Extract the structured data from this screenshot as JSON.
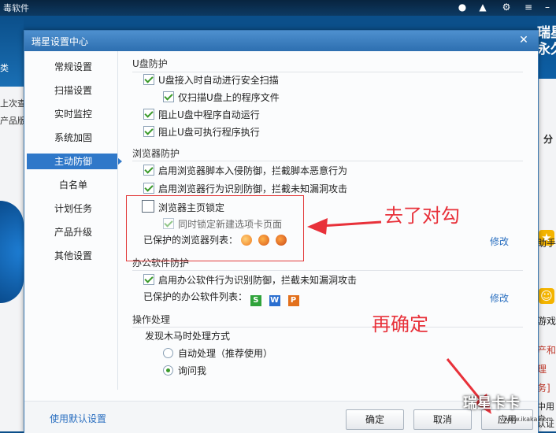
{
  "background_app": {
    "title_fragment": "毒软件",
    "top_icons": [
      "user-icon",
      "upload-icon",
      "settings-icon",
      "menu-icon"
    ],
    "left_texts": [
      "类",
      "上次查",
      "产品版"
    ],
    "right_title": "瑞星",
    "right_subtitle": "永久",
    "right_texts": [
      "分",
      "助手",
      "游戏",
      "产和",
      "理",
      "务]",
      "中用户",
      "认证"
    ]
  },
  "dialog": {
    "title": "瑞星设置中心",
    "close_symbol": "✕"
  },
  "sidebar": {
    "items": [
      {
        "label": "常规设置",
        "active": false
      },
      {
        "label": "扫描设置",
        "active": false
      },
      {
        "label": "实时监控",
        "active": false
      },
      {
        "label": "系统加固",
        "active": false
      },
      {
        "label": "主动防御",
        "active": true
      },
      {
        "label": "白名单",
        "active": false
      },
      {
        "label": "计划任务",
        "active": false
      },
      {
        "label": "产品升级",
        "active": false
      },
      {
        "label": "其他设置",
        "active": false
      }
    ]
  },
  "usb": {
    "title": "U盘防护",
    "options": [
      {
        "label": "U盘接入时自动进行安全扫描",
        "checked": true
      },
      {
        "label": "仅扫描U盘上的程序文件",
        "checked": true
      },
      {
        "label": "阻止U盘中程序自动运行",
        "checked": true
      },
      {
        "label": "阻止U盘可执行程序执行",
        "checked": true
      }
    ]
  },
  "browser": {
    "title": "浏览器防护",
    "options": [
      {
        "label": "启用浏览器脚本入侵防御，拦截脚本恶意行为",
        "checked": true
      },
      {
        "label": "启用浏览器行为识别防御，拦截未知漏洞攻击",
        "checked": true
      },
      {
        "label": "浏览器主页锁定",
        "checked": false
      },
      {
        "label": "同时锁定新建选项卡页面",
        "checked": true,
        "disabled": true
      }
    ],
    "protected_label": "已保护的浏览器列表：",
    "browsers": [
      {
        "name": "uc-browser-icon",
        "color": "#f07a1e"
      },
      {
        "name": "firefox-icon",
        "color": "#d9591c"
      },
      {
        "name": "firefox-icon-2",
        "color": "#c84a16"
      }
    ],
    "modify_link": "修改"
  },
  "office": {
    "title": "办公软件防护",
    "option": {
      "label": "启用办公软件行为识别防御，拦截未知漏洞攻击",
      "checked": true
    },
    "protected_label": "已保护的办公软件列表：",
    "apps": [
      {
        "name": "wps-spreadsheet-icon",
        "letter": "S",
        "color": "#2fa33b"
      },
      {
        "name": "wps-writer-icon",
        "letter": "W",
        "color": "#2b6fd0"
      },
      {
        "name": "wps-presentation-icon",
        "letter": "P",
        "color": "#e2701c"
      }
    ],
    "modify_link": "修改"
  },
  "operation": {
    "title": "操作处理",
    "subtitle": "发现木马时处理方式",
    "options": [
      {
        "label": "自动处理（推荐使用）",
        "selected": false
      },
      {
        "label": "询问我",
        "selected": true
      }
    ]
  },
  "footer": {
    "default_link": "使用默认设置",
    "ok": "确定",
    "cancel": "取消",
    "apply": "应用"
  },
  "annotations": {
    "unchecked_note": "去了对勾",
    "confirm_note": "再确定",
    "watermark": "瑞星卡卡",
    "watermark_url": "www.ikaka.com",
    "color": "#e8313a"
  }
}
